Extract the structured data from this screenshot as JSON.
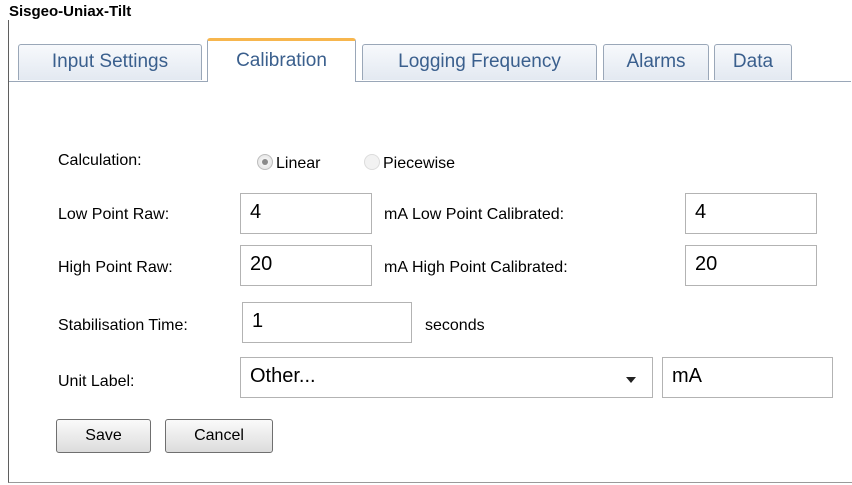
{
  "window": {
    "title": "Sisgeo-Uniax-Tilt"
  },
  "tabs": [
    {
      "label": "Input Settings"
    },
    {
      "label": "Calibration"
    },
    {
      "label": "Logging Frequency"
    },
    {
      "label": "Alarms"
    },
    {
      "label": "Data"
    }
  ],
  "calibration": {
    "calculation_label": "Calculation:",
    "calculation_options": [
      {
        "label": "Linear",
        "selected": true
      },
      {
        "label": "Piecewise",
        "selected": false
      }
    ],
    "low_raw_label": "Low Point Raw:",
    "low_raw_value": "4",
    "low_raw_unit": "mA",
    "low_cal_label": "Low Point Calibrated:",
    "low_cal_value": "4",
    "high_raw_label": "High Point Raw:",
    "high_raw_value": "20",
    "high_raw_unit": "mA",
    "high_cal_label": "High Point Calibrated:",
    "high_cal_value": "20",
    "stab_label": "Stabilisation Time:",
    "stab_value": "1",
    "stab_unit": "seconds",
    "unit_label": "Unit Label:",
    "unit_select_value": "Other...",
    "unit_custom_value": "mA"
  },
  "buttons": {
    "save": "Save",
    "cancel": "Cancel"
  }
}
